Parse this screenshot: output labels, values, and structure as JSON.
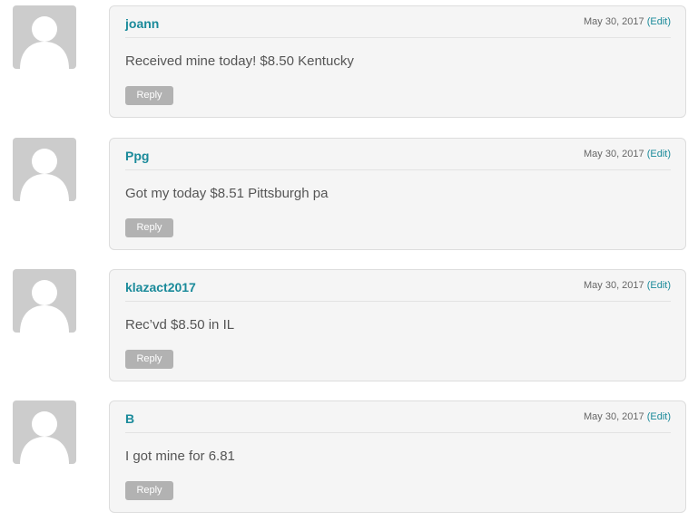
{
  "comments": [
    {
      "author": "joann",
      "date": "May 30, 2017",
      "edit_label": "(Edit)",
      "text": "Received mine today! $8.50 Kentucky",
      "reply_label": "Reply"
    },
    {
      "author": "Ppg",
      "date": "May 30, 2017",
      "edit_label": "(Edit)",
      "text": "Got my today $8.51 Pittsburgh pa",
      "reply_label": "Reply"
    },
    {
      "author": "klazact2017",
      "date": "May 30, 2017",
      "edit_label": "(Edit)",
      "text": "Rec’vd $8.50 in IL",
      "reply_label": "Reply"
    },
    {
      "author": "B",
      "date": "May 30, 2017",
      "edit_label": "(Edit)",
      "text": "I got mine for 6.81",
      "reply_label": "Reply"
    }
  ]
}
